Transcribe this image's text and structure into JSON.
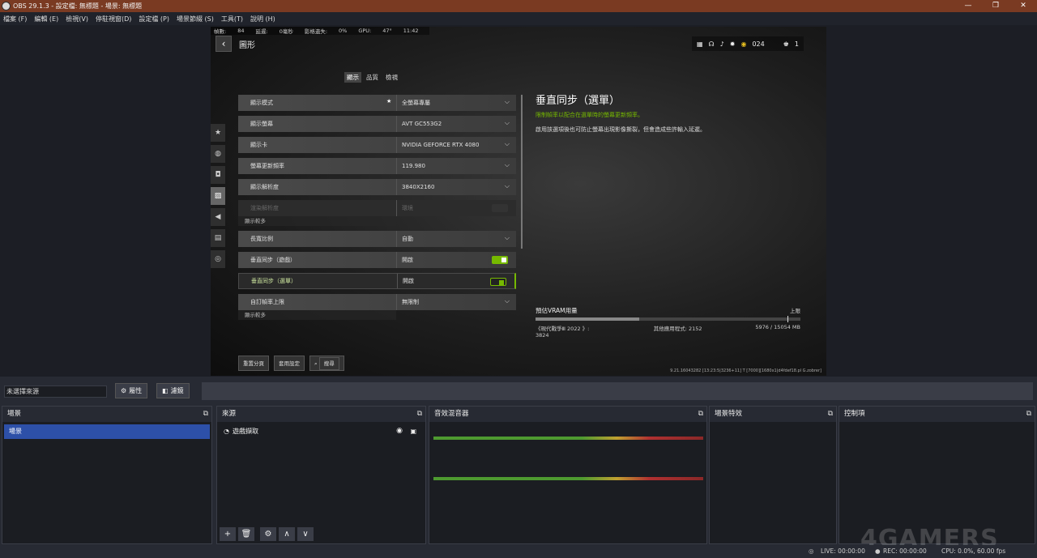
{
  "window": {
    "title": "OBS 29.1.3 - 設定檔: 無標題 - 場景: 無標題",
    "minimize": "—",
    "maximize": "❐",
    "close": "✕"
  },
  "menu": [
    "檔案 (F)",
    "編輯 (E)",
    "檢視(V)",
    "停駐視窗(D)",
    "設定檔 (P)",
    "場景節綴 (S)",
    "工具(T)",
    "說明 (H)"
  ],
  "stats": [
    "幀數:",
    "84",
    "延遲:",
    "0毫秒",
    "影格遺失:",
    "0%",
    "GPU:",
    "47°",
    "11:42"
  ],
  "game": {
    "page_title": "圖形",
    "top_badge": "024",
    "top_count": "1",
    "tabs": [
      "顯示",
      "品質",
      "檢視"
    ],
    "settings": [
      {
        "label": "顯示模式",
        "value": "全螢幕專屬"
      },
      {
        "label": "顯示螢幕",
        "value": "AVT GC553G2"
      },
      {
        "label": "顯示卡",
        "value": "NVIDIA GEFORCE RTX 4080"
      },
      {
        "label": "螢幕更新頻率",
        "value": "119.980"
      },
      {
        "label": "顯示解析度",
        "value": "3840X2160"
      },
      {
        "label": "渲染解析度",
        "value": "環境"
      },
      {
        "label": "長寬比例",
        "value": "自動"
      },
      {
        "label": "垂直同步（遊戲）",
        "value": "開啟"
      },
      {
        "label": "垂直同步（選單）",
        "value": "開啟"
      },
      {
        "label": "自訂幀率上限",
        "value": "無限制"
      }
    ],
    "sub_label": "顯示較多",
    "desc_title": "垂直同步（選單）",
    "desc_green": "限制幀率以配合在選單時的螢幕更新頻率。",
    "desc_text": "啟用該選項後也可防止螢幕出現影像撕裂，但會造成些許輸入延遲。",
    "vram": {
      "title": "預估VRAM用量",
      "limit": "上限",
      "fraction": 0.39,
      "item1": "《現代戰爭Ⅲ 2022 》: 3824",
      "item2": "其他應用程式: 2152",
      "total": "5976 / 15054 MB"
    },
    "buttons": [
      "重置分頁",
      "套用設定",
      "搜尋"
    ],
    "build": "9.21.16043282 [13:23:5|3236+11] T [7000][1680x1|d4fdef18.pl G.zobrer]"
  },
  "source_bar": {
    "name": "未選擇來源",
    "props": "屬性",
    "filters": "濾鏡"
  },
  "docks": {
    "scenes": {
      "title": "場景",
      "items": [
        "場景"
      ]
    },
    "sources": {
      "title": "來源",
      "items": [
        "遊戲擷取"
      ]
    },
    "mixer": {
      "title": "音效混音器"
    },
    "transitions": {
      "title": "場景特效"
    },
    "controls": {
      "title": "控制項"
    }
  },
  "status": {
    "live": "LIVE: 00:00:00",
    "rec": "REC: 00:00:00",
    "cpu": "CPU: 0.0%, 60.00 fps"
  },
  "watermark": "4GAMERS"
}
